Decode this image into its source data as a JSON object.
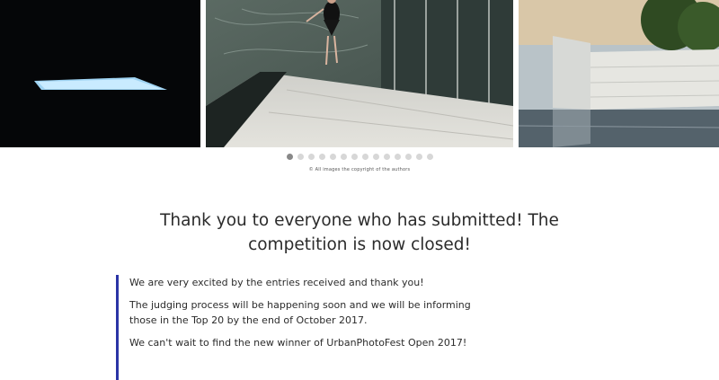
{
  "gallery": {
    "slides": [
      {
        "label": "Dark room with light skylight"
      },
      {
        "label": "Dancer on marble terrace by glass pavilion"
      },
      {
        "label": "Travertine walls and reflecting pool"
      }
    ],
    "dots_count": 14,
    "active_dot": 0,
    "credit": "© All images the copyright of the authors"
  },
  "content": {
    "headline": "Thank you to everyone who has submitted! The competition is now closed!",
    "paragraphs": [
      "We are very excited by the entries received and thank you!",
      "The judging process will be happening soon and we will be informing those in the Top 20 by the end of October 2017.",
      "We can't wait to find the new winner of UrbanPhotoFest Open 2017!"
    ]
  },
  "colors": {
    "accent_bar": "#2b34a6",
    "dot_active": "#888888",
    "dot_inactive": "#d7d7d7"
  }
}
